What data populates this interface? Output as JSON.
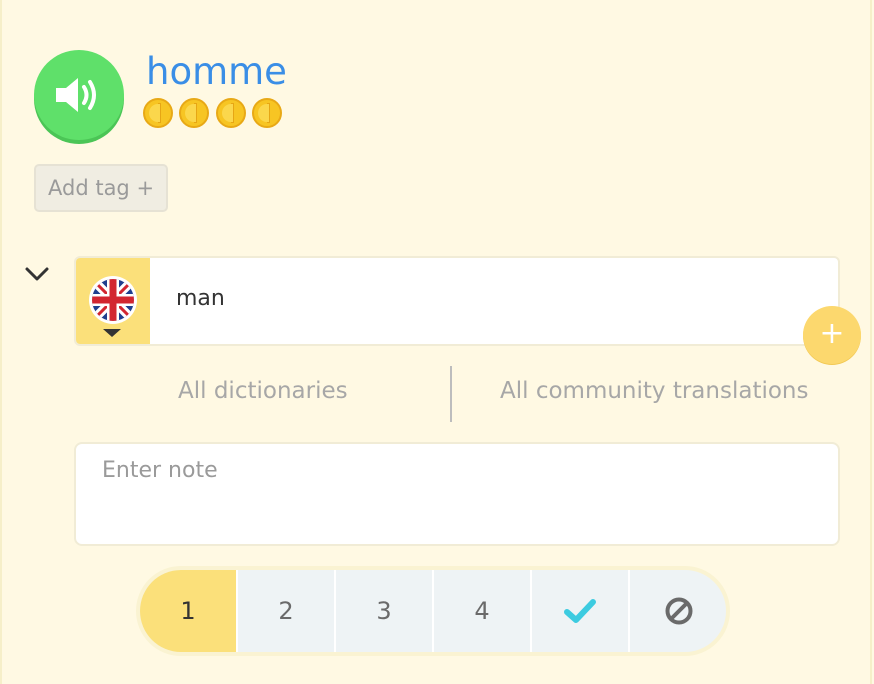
{
  "word": {
    "text": "homme",
    "speaker_icon": "speaker-icon",
    "mastery_coins": 4
  },
  "tags": {
    "add_tag_label": "Add tag +"
  },
  "translation": {
    "language_icon": "uk-flag-icon",
    "text": "man",
    "add_button_label": "+"
  },
  "links": {
    "dictionaries": "All dictionaries",
    "community": "All community translations"
  },
  "note": {
    "placeholder": "Enter note"
  },
  "rating": {
    "options": [
      "1",
      "2",
      "3",
      "4"
    ],
    "selected": "1",
    "known_icon": "check-icon",
    "ignore_icon": "ban-icon"
  },
  "colors": {
    "background": "#fff9e3",
    "speaker_green": "#5fe06a",
    "word_blue": "#3a8ee6",
    "coin_gold": "#f7c523",
    "accent_yellow": "#fbe07a",
    "check_cyan": "#3ccbe0"
  }
}
